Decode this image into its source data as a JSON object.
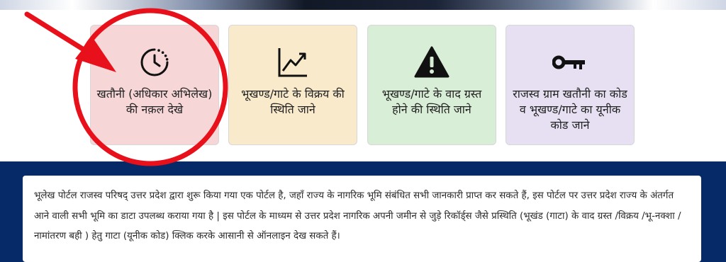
{
  "tiles": [
    {
      "label": "खतौनी (अधिकार अभिलेख) की नक़ल देखे",
      "icon": "clock-icon",
      "background": "#f6d6d6"
    },
    {
      "label": "भूखण्ड/गाटे के विक्रय की स्थिति जाने",
      "icon": "trend-chart-icon",
      "background": "#faeacc"
    },
    {
      "label": "भूखण्ड/गाटे के वाद ग्रस्त होने की स्थिति जाने",
      "icon": "warning-icon",
      "background": "#d9eed6"
    },
    {
      "label": "राजस्व ग्राम खतौनी का कोड व भूखण्ड/गाटे का यूनीक कोड जाने",
      "icon": "key-icon",
      "background": "#e6e0f2"
    }
  ],
  "info": {
    "text": "भूलेख पोर्टल राजस्व परिषद् उत्तर प्रदेश द्वारा शुरू किया गया एक पोर्टल है, जहाँ राज्य के नागरिक भूमि संबंधित सभी जानकारी प्राप्त कर सकते हैं, इस पोर्टल पर उत्तर प्रदेश राज्य के अंतर्गत आने वाली सभी भूमि का डाटा उपलब्ध कराया गया है | इस पोर्टल के माध्यम से उत्तर प्रदेश नागरिक अपनी जमीन से जुड़े रिकॉर्ड्स जैसे प्रस्थिति (भूखंड (गाटा) के वाद ग्रस्त /विक्रय /भू-नक्शा /नामांतरण बही ) हेतु गाटा (यूनीक कोड) क्लिक करके आसानी से ऑनलाइन देख सकते हैं।"
  },
  "colors": {
    "navy_band": "#062a67",
    "annotation_red": "#e8101a"
  }
}
